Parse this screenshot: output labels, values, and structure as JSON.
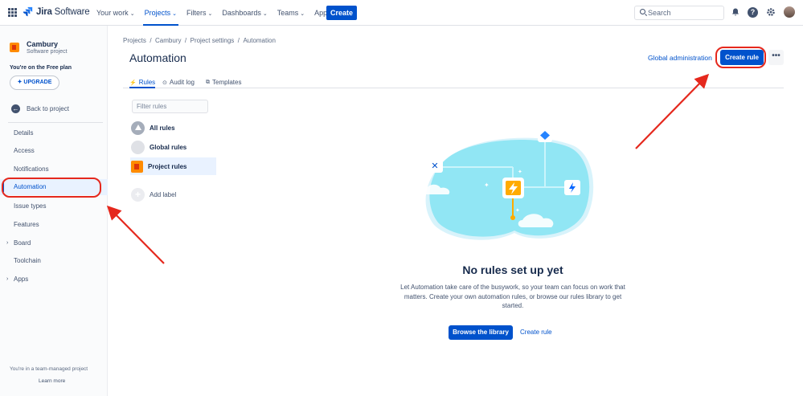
{
  "topbar": {
    "logo_brand": "Jira",
    "logo_product": " Software",
    "nav": [
      {
        "label": "Your work",
        "caret": "⌄"
      },
      {
        "label": "Projects",
        "caret": "⌄"
      },
      {
        "label": "Filters",
        "caret": "⌄"
      },
      {
        "label": "Dashboards",
        "caret": "⌄"
      },
      {
        "label": "Teams",
        "caret": "⌄"
      },
      {
        "label": "Apps",
        "caret": "⌄"
      }
    ],
    "create_label": "Create",
    "search_placeholder": "Search",
    "help_glyph": "?"
  },
  "sidebar": {
    "project_name": "Cambury",
    "project_type": "Software project",
    "plan_text": "You're on the Free plan",
    "upgrade_label": "UPGRADE",
    "back_label": "Back to project",
    "items": [
      "Details",
      "Access",
      "Notifications",
      "Automation",
      "Issue types",
      "Features",
      "Board",
      "Toolchain",
      "Apps"
    ],
    "team_note": "You're in a team-managed project",
    "learn_more": "Learn more"
  },
  "main": {
    "breadcrumb": [
      "Projects",
      "Cambury",
      "Project settings",
      "Automation"
    ],
    "breadcrumb_sep": "  /  ",
    "title": "Automation",
    "global_admin": "Global administration",
    "create_rule": "Create rule",
    "more_glyph": "•••",
    "tabs": [
      "Rules",
      "Audit log",
      "Templates"
    ],
    "filter_placeholder": "Filter rules",
    "labels": [
      "All rules",
      "Global rules",
      "Project rules"
    ],
    "add_label": "Add label",
    "empty_title": "No rules set up yet",
    "empty_desc": "Let Automation take care of the busywork, so your team can focus on work that matters. Create your own automation rules, or browse our rules library to get started.",
    "browse_label": "Browse the library",
    "create_rule_link": "Create rule"
  },
  "colors": {
    "accent": "#0052cc",
    "annotation": "#e5281d"
  }
}
